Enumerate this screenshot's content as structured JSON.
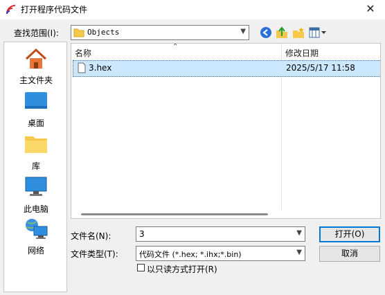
{
  "window": {
    "title": "打开程序代码文件",
    "close_glyph": "✕"
  },
  "lookin": {
    "label": "查找范围(I):",
    "value": "Objects"
  },
  "places": [
    {
      "label": "主文件夹",
      "icon": "home-icon"
    },
    {
      "label": "桌面",
      "icon": "desktop-icon"
    },
    {
      "label": "库",
      "icon": "library-icon"
    },
    {
      "label": "此电脑",
      "icon": "computer-icon"
    },
    {
      "label": "网络",
      "icon": "network-icon"
    }
  ],
  "filelist": {
    "col_name": "名称",
    "col_modified": "修改日期",
    "files": [
      {
        "name": "3.hex",
        "modified": "2025/5/17 11:58"
      }
    ]
  },
  "filename": {
    "label": "文件名(N):",
    "value": "3"
  },
  "filetype": {
    "label": "文件类型(T):",
    "value": "代码文件 (*.hex; *.ihx;*.bin)"
  },
  "readonly": {
    "label": "以只读方式打开(R)",
    "checked": false
  },
  "buttons": {
    "open": "打开(O)",
    "cancel": "取消"
  },
  "colors": {
    "accent": "#0078d7",
    "selection": "#cce8ff",
    "folder": "#f6c94a"
  }
}
